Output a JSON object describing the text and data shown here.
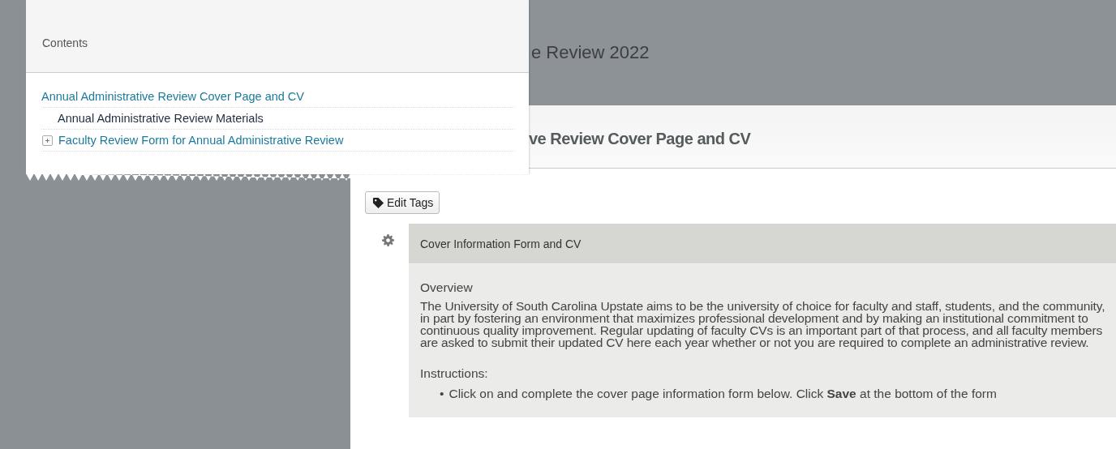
{
  "page": {
    "title": "e Review 2022",
    "subtitle": "ve Review Cover Page and CV"
  },
  "contents": {
    "title": "Contents",
    "items": [
      {
        "label": "Annual Administrative Review Cover Page and CV",
        "selected": false,
        "children": [
          {
            "label": "Annual Administrative Review Materials",
            "selected": true
          },
          {
            "label": "Faculty Review Form for Annual Administrative Review",
            "selected": false,
            "expanded": false
          }
        ]
      }
    ]
  },
  "edit_tags": {
    "label": "Edit Tags"
  },
  "form": {
    "title": "Cover Information Form and CV",
    "overview_heading": "Overview",
    "overview": "The University of South Carolina Upstate aims to be the university of choice for faculty and staff, students, and the community, in part by fostering an environment that maximizes professional development and by making an institutional commitment to continuous quality improvement. Regular updating of faculty CVs is an important part of that process, and all faculty members are asked to submit their updated CV here each year whether or not you are required to complete an administrative review.",
    "instructions_heading": "Instructions:",
    "instructions": [
      {
        "marker": "•",
        "text": "Click on and complete the cover page information form below. Click **Save** at the bottom of the form"
      }
    ]
  }
}
